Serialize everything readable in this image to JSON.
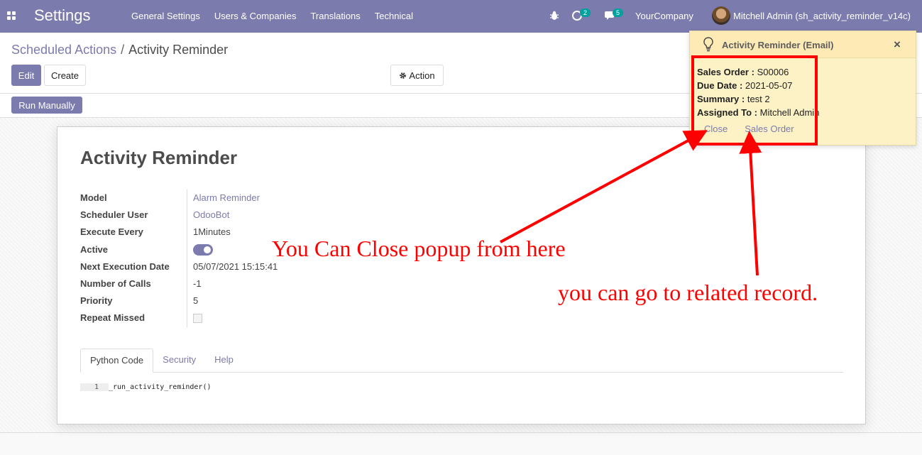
{
  "navbar": {
    "app_name": "Settings",
    "menu": [
      "General Settings",
      "Users & Companies",
      "Translations",
      "Technical"
    ],
    "activity_count": "2",
    "message_count": "5",
    "company": "YourCompany",
    "user": "Mitchell Admin (sh_activity_reminder_v14c)"
  },
  "control_panel": {
    "breadcrumb_parent": "Scheduled Actions",
    "breadcrumb_separator": "/",
    "breadcrumb_current": "Activity Reminder",
    "edit_label": "Edit",
    "create_label": "Create",
    "action_label": "Action",
    "run_manually_label": "Run Manually"
  },
  "record": {
    "title": "Activity Reminder",
    "fields": [
      {
        "label": "Model",
        "value": "Alarm Reminder"
      },
      {
        "label": "Scheduler User",
        "value": "OdooBot"
      },
      {
        "label": "Execute Every",
        "value": "1Minutes"
      },
      {
        "label": "Active",
        "value": true
      },
      {
        "label": "Next Execution Date",
        "value": "05/07/2021 15:15:41"
      },
      {
        "label": "Number of Calls",
        "value": "-1"
      },
      {
        "label": "Priority",
        "value": "5"
      },
      {
        "label": "Repeat Missed",
        "value": false
      }
    ],
    "tabs": [
      "Python Code",
      "Security",
      "Help"
    ],
    "code_line_number": "1",
    "code": "_run_activity_reminder()"
  },
  "popup": {
    "title": "Activity Reminder (Email)",
    "rows": [
      {
        "label": "Sales Order :",
        "value": "S00006"
      },
      {
        "label": "Due Date :",
        "value": "2021-05-07"
      },
      {
        "label": "Summary :",
        "value": "test 2"
      },
      {
        "label": "Assigned To :",
        "value": "Mitchell Admin"
      }
    ],
    "close_link": "Close",
    "record_link": "Sales Order"
  },
  "annotations": {
    "close_hint": "You Can Close popup from here",
    "record_hint": "you can go to related record."
  },
  "colors": {
    "primary": "#7c7bad",
    "popup_bg": "#fdf2c6",
    "annotation": "#ff0000"
  }
}
